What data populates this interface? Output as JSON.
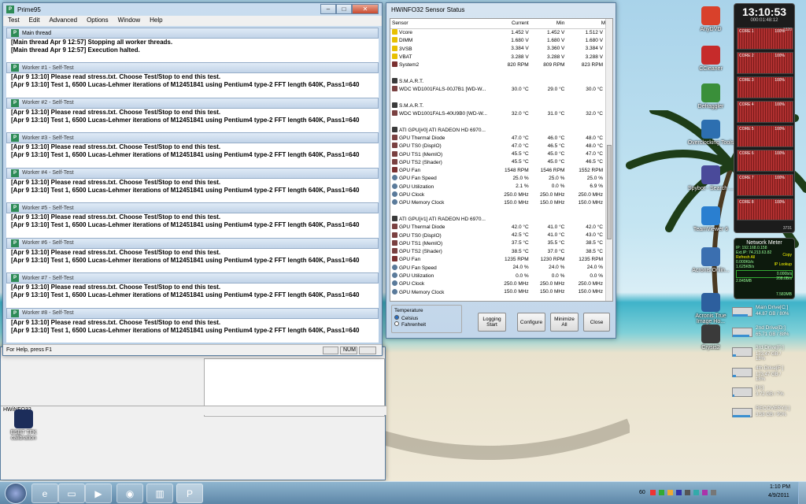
{
  "prime95": {
    "title": "Prime95",
    "menu": [
      "Test",
      "Edit",
      "Advanced",
      "Options",
      "Window",
      "Help"
    ],
    "main_thread": {
      "title": "Main thread",
      "lines": [
        "[Main thread Apr 9 12:57] Stopping all worker threads.",
        "[Main thread Apr 9 12:57] Execution halted."
      ]
    },
    "workers": [
      {
        "title": "Worker #1 - Self-Test",
        "lines": [
          "[Apr 9 13:10] Please read stress.txt.  Choose Test/Stop to end this test.",
          "[Apr 9 13:10] Test 1, 6500 Lucas-Lehmer iterations of M12451841 using Pentium4 type-2 FFT length 640K, Pass1=640"
        ]
      },
      {
        "title": "Worker #2 - Self-Test",
        "lines": [
          "[Apr 9 13:10] Please read stress.txt.  Choose Test/Stop to end this test.",
          "[Apr 9 13:10] Test 1, 6500 Lucas-Lehmer iterations of M12451841 using Pentium4 type-2 FFT length 640K, Pass1=640"
        ]
      },
      {
        "title": "Worker #3 - Self-Test",
        "lines": [
          "[Apr 9 13:10] Please read stress.txt.  Choose Test/Stop to end this test.",
          "[Apr 9 13:10] Test 1, 6500 Lucas-Lehmer iterations of M12451841 using Pentium4 type-2 FFT length 640K, Pass1=640"
        ]
      },
      {
        "title": "Worker #4 - Self-Test",
        "lines": [
          "[Apr 9 13:10] Please read stress.txt.  Choose Test/Stop to end this test.",
          "[Apr 9 13:10] Test 1, 6500 Lucas-Lehmer iterations of M12451841 using Pentium4 type-2 FFT length 640K, Pass1=640"
        ]
      },
      {
        "title": "Worker #5 - Self-Test",
        "lines": [
          "[Apr 9 13:10] Please read stress.txt.  Choose Test/Stop to end this test.",
          "[Apr 9 13:10] Test 1, 6500 Lucas-Lehmer iterations of M12451841 using Pentium4 type-2 FFT length 640K, Pass1=640"
        ]
      },
      {
        "title": "Worker #6 - Self-Test",
        "lines": [
          "[Apr 9 13:10] Please read stress.txt.  Choose Test/Stop to end this test.",
          "[Apr 9 13:10] Test 1, 6500 Lucas-Lehmer iterations of M12451841 using Pentium4 type-2 FFT length 640K, Pass1=640"
        ]
      },
      {
        "title": "Worker #7 - Self-Test",
        "lines": [
          "[Apr 9 13:10] Please read stress.txt.  Choose Test/Stop to end this test.",
          "[Apr 9 13:10] Test 1, 6500 Lucas-Lehmer iterations of M12451841 using Pentium4 type-2 FFT length 640K, Pass1=640"
        ]
      },
      {
        "title": "Worker #8 - Self-Test",
        "lines": [
          "[Apr 9 13:10] Please read stress.txt.  Choose Test/Stop to end this test.",
          "[Apr 9 13:10] Test 1, 6500 Lucas-Lehmer iterations of M12451841 using Pentium4 type-2 FFT length 640K, Pass1=640"
        ]
      }
    ],
    "status_text": "For Help, press F1",
    "status_num": "NUM"
  },
  "hwinfo": {
    "title": "HWiNFO32 Sensor Status",
    "columns": [
      "Sensor",
      "Current",
      "Min",
      "Max"
    ],
    "rows": [
      {
        "icon": "volt",
        "name": "Vcore",
        "cur": "1.452 V",
        "min": "1.452 V",
        "max": "1.512 V"
      },
      {
        "icon": "volt",
        "name": "DIMM",
        "cur": "1.680 V",
        "min": "1.680 V",
        "max": "1.680 V"
      },
      {
        "icon": "volt",
        "name": "3VSB",
        "cur": "3.384 V",
        "min": "3.360 V",
        "max": "3.384 V"
      },
      {
        "icon": "volt",
        "name": "VBAT",
        "cur": "3.288 V",
        "min": "3.288 V",
        "max": "3.288 V"
      },
      {
        "icon": "fan",
        "name": "System2",
        "cur": "820 RPM",
        "min": "809 RPM",
        "max": "823 RPM"
      },
      {
        "icon": "blank",
        "name": "",
        "cur": "",
        "min": "",
        "max": ""
      },
      {
        "icon": "chip",
        "name": "S.M.A.R.T.",
        "cur": "",
        "min": "",
        "max": ""
      },
      {
        "icon": "temp",
        "name": "WDC WD1001FALS-00J7B1 [WD-W...",
        "cur": "30.0 °C",
        "min": "29.0 °C",
        "max": "30.0 °C"
      },
      {
        "icon": "blank",
        "name": "",
        "cur": "",
        "min": "",
        "max": ""
      },
      {
        "icon": "chip",
        "name": "S.M.A.R.T.",
        "cur": "",
        "min": "",
        "max": ""
      },
      {
        "icon": "temp",
        "name": "WDC WD1001FALS-40U9B0 [WD-W...",
        "cur": "32.0 °C",
        "min": "31.0 °C",
        "max": "32.0 °C"
      },
      {
        "icon": "blank",
        "name": "",
        "cur": "",
        "min": "",
        "max": ""
      },
      {
        "icon": "chip",
        "name": "ATI GPU[#0] ATI RADEON HD 6970...",
        "cur": "",
        "min": "",
        "max": ""
      },
      {
        "icon": "temp",
        "name": "GPU Thermal Diode",
        "cur": "47.0 °C",
        "min": "46.0 °C",
        "max": "48.0 °C"
      },
      {
        "icon": "temp",
        "name": "GPU TS0 (DispIO)",
        "cur": "47.0 °C",
        "min": "46.5 °C",
        "max": "48.0 °C"
      },
      {
        "icon": "temp",
        "name": "GPU TS1 (MemIO)",
        "cur": "45.5 °C",
        "min": "45.0 °C",
        "max": "47.0 °C"
      },
      {
        "icon": "temp",
        "name": "GPU TS2 (Shader)",
        "cur": "45.5 °C",
        "min": "45.0 °C",
        "max": "46.5 °C"
      },
      {
        "icon": "fan",
        "name": "GPU Fan",
        "cur": "1548 RPM",
        "min": "1546 RPM",
        "max": "1552 RPM"
      },
      {
        "icon": "gauge",
        "name": "GPU Fan Speed",
        "cur": "25.0 %",
        "min": "25.0 %",
        "max": "25.0 %"
      },
      {
        "icon": "gauge",
        "name": "GPU Utilization",
        "cur": "2.1 %",
        "min": "0.0 %",
        "max": "6.9 %"
      },
      {
        "icon": "gauge",
        "name": "GPU Clock",
        "cur": "250.0 MHz",
        "min": "250.0 MHz",
        "max": "250.0 MHz"
      },
      {
        "icon": "gauge",
        "name": "GPU Memory Clock",
        "cur": "150.0 MHz",
        "min": "150.0 MHz",
        "max": "150.0 MHz"
      },
      {
        "icon": "blank",
        "name": "",
        "cur": "",
        "min": "",
        "max": ""
      },
      {
        "icon": "chip",
        "name": "ATI GPU[#1] ATI RADEON HD 6970...",
        "cur": "",
        "min": "",
        "max": ""
      },
      {
        "icon": "temp",
        "name": "GPU Thermal Diode",
        "cur": "42.0 °C",
        "min": "41.0 °C",
        "max": "42.0 °C"
      },
      {
        "icon": "temp",
        "name": "GPU TS0 (DispIO)",
        "cur": "42.5 °C",
        "min": "41.0 °C",
        "max": "43.0 °C"
      },
      {
        "icon": "temp",
        "name": "GPU TS1 (MemIO)",
        "cur": "37.5 °C",
        "min": "35.5 °C",
        "max": "38.5 °C"
      },
      {
        "icon": "temp",
        "name": "GPU TS2 (Shader)",
        "cur": "38.5 °C",
        "min": "37.0 °C",
        "max": "38.5 °C"
      },
      {
        "icon": "fan",
        "name": "GPU Fan",
        "cur": "1235 RPM",
        "min": "1230 RPM",
        "max": "1235 RPM"
      },
      {
        "icon": "gauge",
        "name": "GPU Fan Speed",
        "cur": "24.0 %",
        "min": "24.0 %",
        "max": "24.0 %"
      },
      {
        "icon": "gauge",
        "name": "GPU Utilization",
        "cur": "0.0 %",
        "min": "0.0 %",
        "max": "0.0 %"
      },
      {
        "icon": "gauge",
        "name": "GPU Clock",
        "cur": "250.0 MHz",
        "min": "250.0 MHz",
        "max": "250.0 MHz"
      },
      {
        "icon": "gauge",
        "name": "GPU Memory Clock",
        "cur": "150.0 MHz",
        "min": "150.0 MHz",
        "max": "150.0 MHz"
      }
    ],
    "temperature_group": "Temperature",
    "celsius": "Celsius",
    "fahrenheit": "Fahrenheit",
    "btn_logging": "Logging\nStart",
    "btn_configure": "Configure",
    "btn_minimize_all": "Minimize All",
    "btn_close": "Close"
  },
  "bg_window_title": "HWiNFO32",
  "desktop_icons": [
    {
      "label": "AnyDVD",
      "color": "#d9412b"
    },
    {
      "label": "CCleaner",
      "color": "#c62b2b"
    },
    {
      "label": "Defraggler",
      "color": "#3a8f3a"
    },
    {
      "label": "Overclocking Tools",
      "color": "#2d6fb0"
    },
    {
      "label": "Spybot - Search ...",
      "color": "#4a4a9a"
    },
    {
      "label": "TeamViewer 6",
      "color": "#2a7fd0"
    },
    {
      "label": "Acronis Onlin...",
      "color": "#3b6fb0"
    },
    {
      "label": "Acronis True Image Ho...",
      "color": "#2d5f9e"
    },
    {
      "label": "Crysis2",
      "color": "#3a3a3a"
    }
  ],
  "desktop_icon_left": {
    "label": "ESET TFK calibration",
    "color": "#1c2d5a"
  },
  "clock_gadget": {
    "time": "13:10:53",
    "subtime": "000:01:48:12",
    "cores": [
      "CORE 1",
      "CORE 2",
      "CORE 3",
      "CORE 4",
      "CORE 5",
      "CORE 6",
      "CORE 7",
      "CORE 8"
    ],
    "core_pct": [
      "100%",
      "100%",
      "100%",
      "100%",
      "100%",
      "100%",
      "100%",
      "100%"
    ],
    "mem": "1320",
    "speed": "3731"
  },
  "network_meter": {
    "title": "Network Meter",
    "ip": "IP: 192.168.0.158",
    "ext_ip": "Ext.IP: 74.213.63.82",
    "copy": "Copy",
    "refresh": "Refresh All",
    "ip_lookup": "IP Lookup",
    "down": "0.000Kb/s",
    "up": "0.000b/s",
    "speed1": "1.625KB/s",
    "speed2": "208.0B/s",
    "total1": "2.845MB",
    "total2": "7.583MB"
  },
  "drives": [
    {
      "name": "Main Drive[C:]",
      "size": "44.87 GB / 80%",
      "fill": 0.8
    },
    {
      "name": "2nd Drive[D:]",
      "size": "65.71 GB / 88%",
      "fill": 0.88
    },
    {
      "name": "3rd Drive[F:]",
      "size": "173.47 GB / 18%",
      "fill": 0.18
    },
    {
      "name": "4th Drive[F:]",
      "size": "173.47 GB / 18%",
      "fill": 0.18
    },
    {
      "name": "[H:]",
      "size": "3.72 GB / 7%",
      "fill": 0.07
    },
    {
      "name": "RECOVERY[I:]",
      "size": "3.58 GB / 90%",
      "fill": 0.9
    }
  ],
  "taskbar": {
    "items": [
      "start",
      "ie",
      "explorer",
      "media",
      "firefox",
      "winamp",
      "prime95"
    ],
    "tray_num": "60",
    "time": "1:10 PM",
    "date": "4/9/2011"
  }
}
